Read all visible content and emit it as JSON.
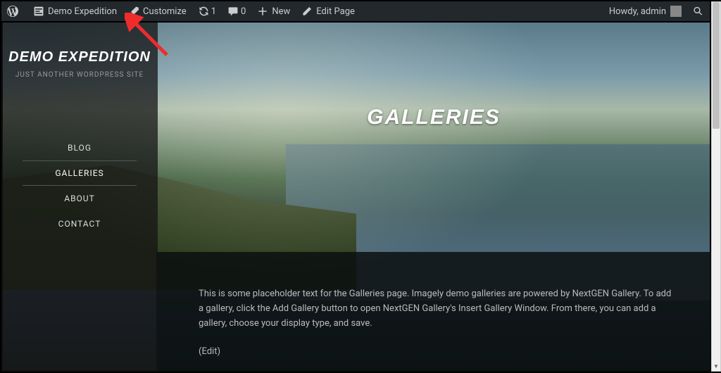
{
  "adminbar": {
    "site_name": "Demo Expedition",
    "customize": "Customize",
    "updates_count": "1",
    "comments_count": "0",
    "new": "New",
    "edit_page": "Edit Page",
    "greeting": "Howdy, admin"
  },
  "sidebar": {
    "site_title": "DEMO EXPEDITION",
    "tagline": "JUST ANOTHER WORDPRESS SITE",
    "nav": [
      {
        "label": "BLOG",
        "active": false
      },
      {
        "label": "GALLERIES",
        "active": true
      },
      {
        "label": "ABOUT",
        "active": false
      },
      {
        "label": "CONTACT",
        "active": false
      }
    ]
  },
  "page": {
    "title": "GALLERIES",
    "body": "This is some placeholder text for the Galleries page. Imagely demo galleries are powered by NextGEN Gallery. To add a gallery, click the Add Gallery button to open NextGEN Gallery's Insert Gallery Window. From there, you can add a gallery, choose your display type, and save.",
    "edit_link": "(Edit)"
  }
}
